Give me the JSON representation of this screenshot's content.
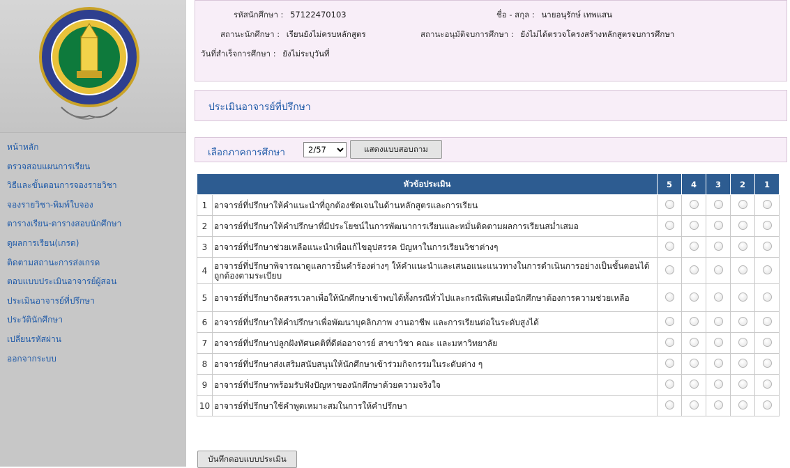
{
  "student": {
    "id_label": "รหัสนักศึกษา :",
    "id_value": "57122470103",
    "name_label": "ชื่อ - สกุล :",
    "name_value": "นายอนุรักษ์ เทพแสน",
    "status_label": "สถานะนักศึกษา :",
    "status_value": "เรียนยังไม่ครบหลักสูตร",
    "approval_label": "สถานะอนุมัติจบการศึกษา :",
    "approval_value": "ยังไม่ได้ตรวจโครงสร้างหลักสูตรจบการศึกษา",
    "grad_label": "วันที่สำเร็จการศึกษา :",
    "grad_value": "ยังไม่ระบุวันที่"
  },
  "sidebar": {
    "items": [
      {
        "label": "หน้าหลัก"
      },
      {
        "label": "ตรวจสอบแผนการเรียน"
      },
      {
        "label": "วิธีและขั้นตอนการจองรายวิชา"
      },
      {
        "label": "จองรายวิชา-พิมพ์ใบจอง"
      },
      {
        "label": "ตารางเรียน-ตารางสอบนักศึกษา"
      },
      {
        "label": "ดูผลการเรียน(เกรด)"
      },
      {
        "label": "ติดตามสถานะการส่งเกรด"
      },
      {
        "label": "ตอบแบบประเมินอาจารย์ผู้สอน"
      },
      {
        "label": "ประเมินอาจารย์ที่ปรึกษา"
      },
      {
        "label": "ประวัตินักศึกษา"
      },
      {
        "label": "เปลี่ยนรหัสผ่าน"
      },
      {
        "label": "ออกจากระบบ"
      }
    ]
  },
  "page_title": "ประเมินอาจารย์ที่ปรึกษา",
  "semester": {
    "label": "เลือกภาคการศึกษา",
    "selected": "2/57",
    "button_label": "แสดงแบบสอบถาม"
  },
  "table": {
    "header_topic": "หัวข้อประเมิน",
    "rating_headers": [
      "5",
      "4",
      "3",
      "2",
      "1"
    ],
    "rows": [
      {
        "num": "1",
        "text": "อาจารย์ที่ปรึกษาให้คำแนะนำที่ถูกต้องชัดเจนในด้านหลักสูตรและการเรียน"
      },
      {
        "num": "2",
        "text": "อาจารย์ที่ปรึกษาให้คำปรึกษาที่มีประโยชน์ในการพัฒนาการเรียนและหมั่นติดตามผลการเรียนสม่ำเสมอ"
      },
      {
        "num": "3",
        "text": "อาจารย์ที่ปรึกษาช่วยเหลือแนะนำเพื่อแก้ไขอุปสรรค ปัญหาในการเรียนวิชาต่างๆ"
      },
      {
        "num": "4",
        "text": "อาจารย์ที่ปรึกษาพิจารณาดูแลการยื่นคำร้องต่างๆ ให้คำแนะนำและเสนอแนะแนวทางในการดำเนินการอย่างเป็นขั้นตอนได้ถูกต้องตามระเบียบ"
      },
      {
        "num": "5",
        "text": "อาจารย์ที่ปรึกษาจัดสรรเวลาเพื่อให้นักศึกษาเข้าพบได้ทั้งกรณีทั่วไปและกรณีพิเศษเมื่อนักศึกษาต้องการความช่วยเหลือ"
      },
      {
        "num": "6",
        "text": "อาจารย์ที่ปรึกษาให้คำปรึกษาเพื่อพัฒนาบุคลิกภาพ งานอาชีพ และการเรียนต่อในระดับสูงได้"
      },
      {
        "num": "7",
        "text": "อาจารย์ที่ปรึกษาปลูกฝังทัศนคติที่ดีต่ออาจารย์ สาขาวิชา คณะ และมหาวิทยาลัย"
      },
      {
        "num": "8",
        "text": "อาจารย์ที่ปรึกษาส่งเสริมสนับสนุนให้นักศึกษาเข้าร่วมกิจกรรมในระดับต่าง ๆ"
      },
      {
        "num": "9",
        "text": "อาจารย์ที่ปรึกษาพร้อมรับฟังปัญหาของนักศึกษาด้วยความจริงใจ"
      },
      {
        "num": "10",
        "text": "อาจารย์ที่ปรึกษาใช้คำพูดเหมาะสมในการให้คำปรึกษา"
      }
    ]
  },
  "submit_label": "บันทึกตอบแบบประเมิน",
  "colors": {
    "header_blue": "#2d5c91",
    "link_blue": "#1f5aa8",
    "panel_pink": "#f8eef8",
    "sidebar_gray": "#c7c7c7"
  }
}
